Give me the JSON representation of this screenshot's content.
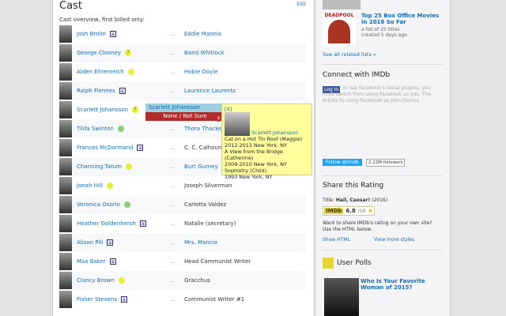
{
  "cast": {
    "title": "Cast",
    "edit": "Edit",
    "subtitle": "Cast overview, first billed only:",
    "rows": [
      {
        "actor": "Josh Brolin",
        "badge": "a",
        "character": "Eddie Mannix",
        "link": true
      },
      {
        "actor": "George Clooney",
        "badge": "?",
        "character": "Baird Whitlock",
        "link": true
      },
      {
        "actor": "Alden Ehrenreich",
        "badge": "y",
        "character": "Hobie Doyle",
        "link": true
      },
      {
        "actor": "Ralph Fiennes",
        "badge": "a",
        "character": "Laurence Laurentz",
        "link": true
      },
      {
        "actor": "Scarlett Johansson",
        "badge": "?",
        "character": "",
        "link": true
      },
      {
        "actor": "Tilda Swinton",
        "badge": "g",
        "character": "Thora Thacker",
        "link": true
      },
      {
        "actor": "Frances McDormand",
        "badge": "a",
        "character": "C. C. Calhoun",
        "link": false
      },
      {
        "actor": "Channing Tatum",
        "badge": "y",
        "character": "Burt Gurney",
        "link": true
      },
      {
        "actor": "Jonah Hill",
        "badge": "y",
        "character": "Joseph Silverman",
        "link": false
      },
      {
        "actor": "Veronica Osorio",
        "badge": "g",
        "character": "Carlotta Valdez",
        "link": false
      },
      {
        "actor": "Heather Goldenhersh",
        "badge": "a",
        "character": "Natalie (secretary)",
        "link": false
      },
      {
        "actor": "Alison Pill",
        "badge": "a",
        "character": "Mrs. Mannix",
        "link": true
      },
      {
        "actor": "Max Baker",
        "badge": "a",
        "character": "Head Communist Writer",
        "link": false
      },
      {
        "actor": "Clancy Brown",
        "badge": "y",
        "character": "Gracchus",
        "link": false
      },
      {
        "actor": "Fisher Stevens",
        "badge": "a",
        "character": "Communist Writer #1",
        "link": false
      }
    ],
    "dots": "..."
  },
  "dropdown": {
    "option1": "Scarlett Johansson",
    "option2": "None / Not Sure",
    "close": "x"
  },
  "tooltip": {
    "close": "[X]",
    "name": "Scarlett Johansson",
    "lines": [
      "Cat on a Hot Tin Roof (Maggie)",
      "2012-2013 New York, NY",
      "A View from the Bridge (Catherine)",
      "2009-2010 New York, NY",
      "Sophistry (Child)",
      "1993 New York, NY"
    ]
  },
  "sidebar": {
    "list_title": "Top 25 Box Office Movies in 2016 So Far",
    "list_meta1": "a list of 25 titles",
    "list_meta2": "created 5 days ago",
    "poster_text": "DEADPOOL",
    "see_all": "See all related lists »",
    "connect_title": "Connect with IMDb",
    "login": "Log In",
    "connect_text": "In use Facebook's social plugins, you must switch from using Facebook as you. The Artists to using Facebook as John Davina",
    "follow": "Follow @imdb",
    "followers": "2.22M followers",
    "share_title": "Share this Rating",
    "title_label": "Title:",
    "title_value": "Hail, Caesar!",
    "title_year": "(2016)",
    "imdb": "IMDb",
    "rating": "6.8",
    "rating_max": "/10",
    "share_text": "Want to share IMDb's rating on your own site? Use the HTML below.",
    "show_html": "Show HTML",
    "more_styles": "View more styles",
    "polls_title": "User Polls",
    "poll_q": "Who Is Your Favorite Woman of 2015?"
  }
}
